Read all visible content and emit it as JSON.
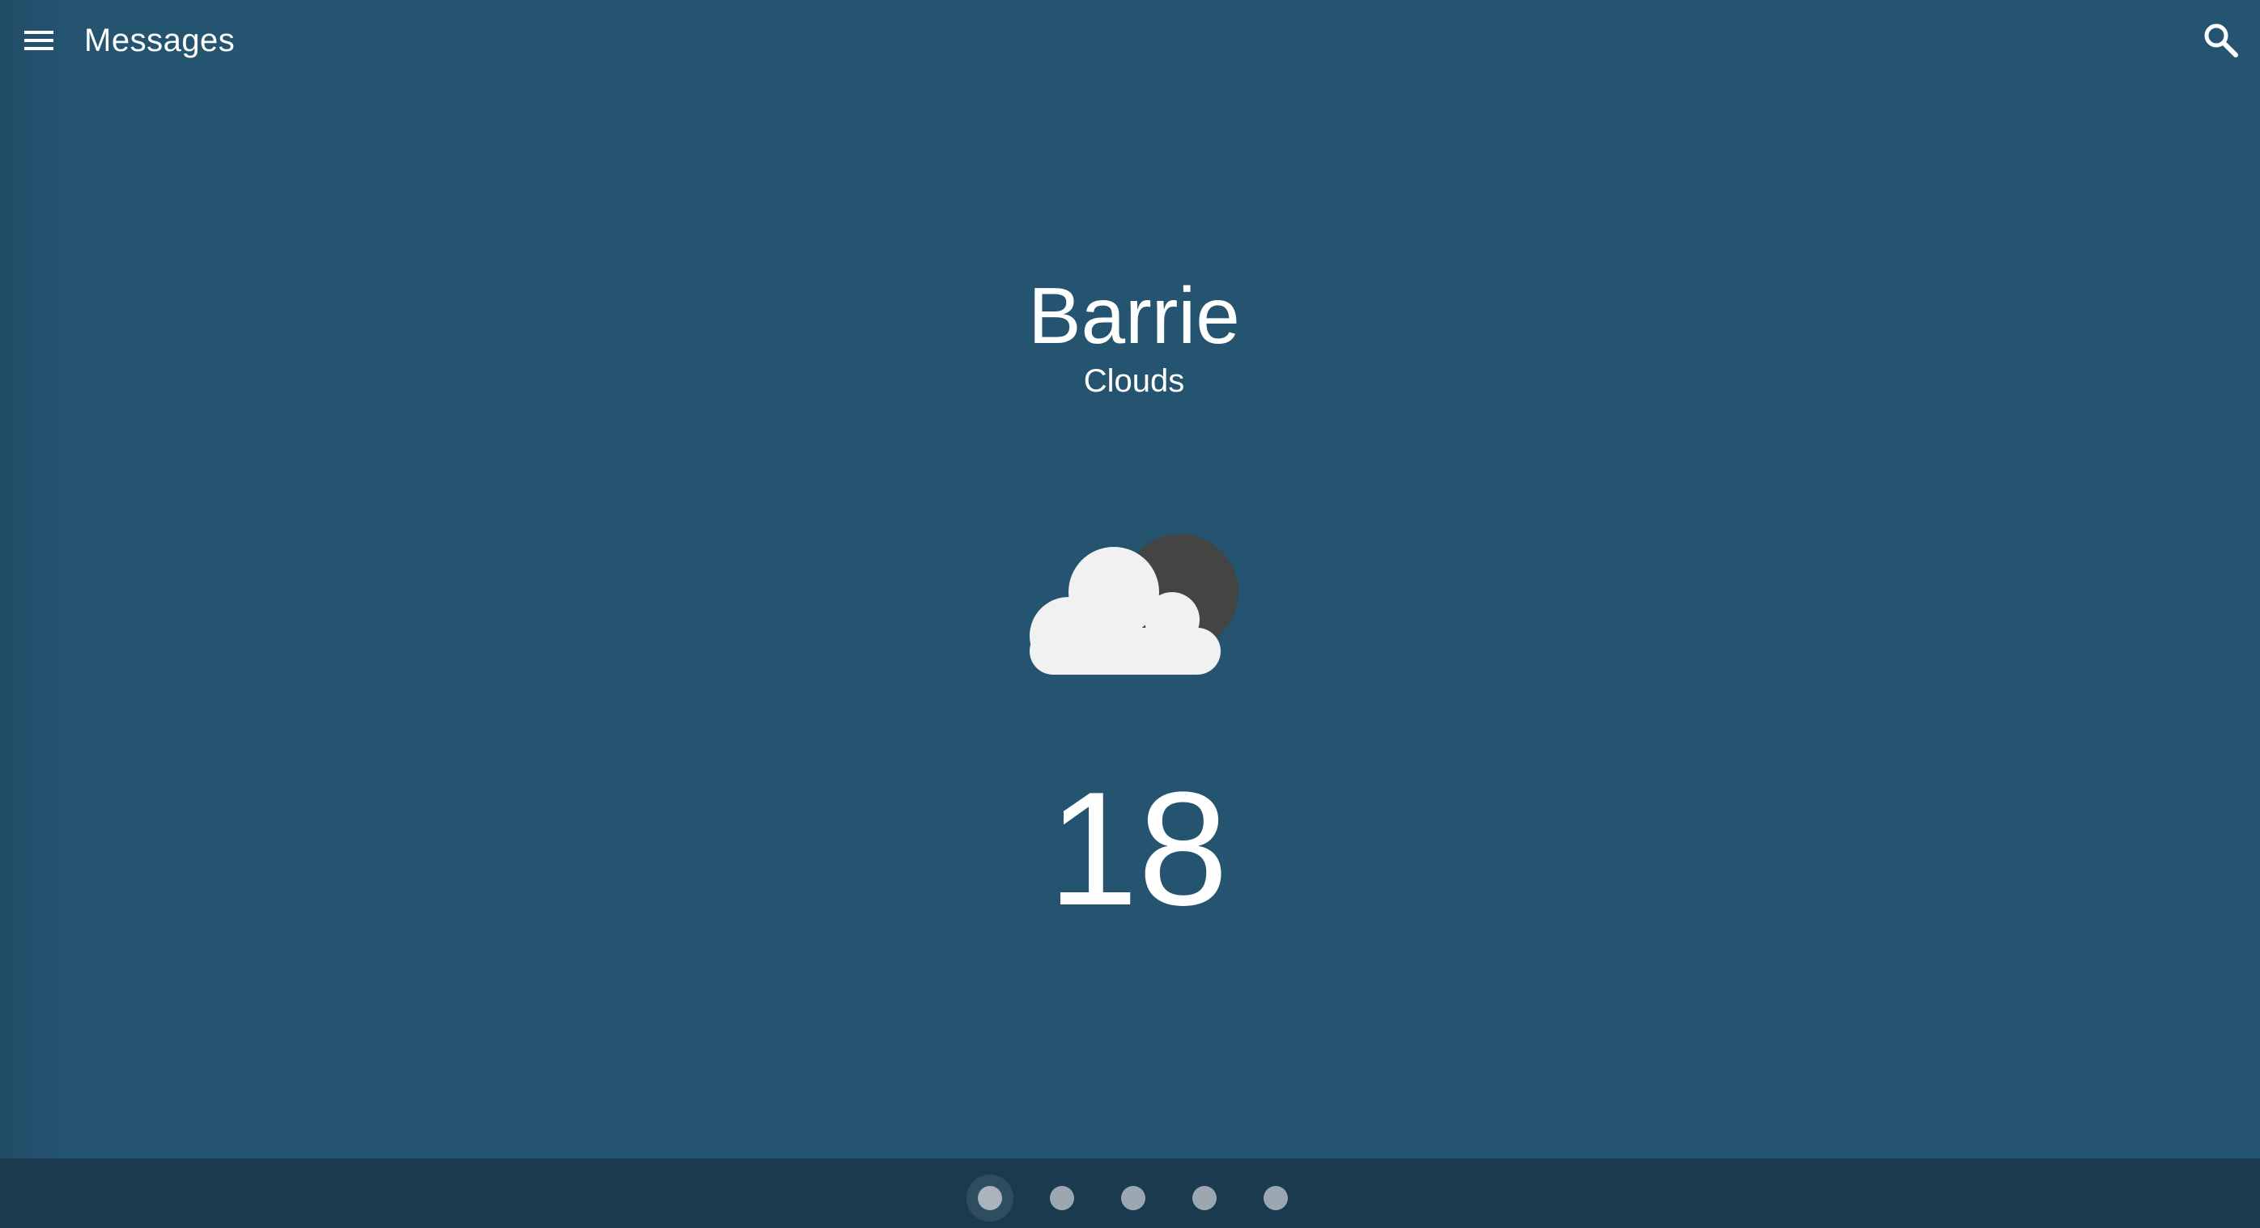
{
  "header": {
    "title": "Messages",
    "menu_icon": "menu-icon",
    "search_icon": "search-icon"
  },
  "weather": {
    "city": "Barrie",
    "condition": "Clouds",
    "icon": "cloud-moon-icon",
    "temperature": "18"
  },
  "pager": {
    "page_count": 5,
    "active_page": 1
  },
  "colors": {
    "background": "#255470",
    "bottom_bar": "#1b3a4f",
    "text": "#ffffff",
    "cloud": "#f1f1f1",
    "moon": "#444444",
    "dot": "#9aa7b1"
  }
}
